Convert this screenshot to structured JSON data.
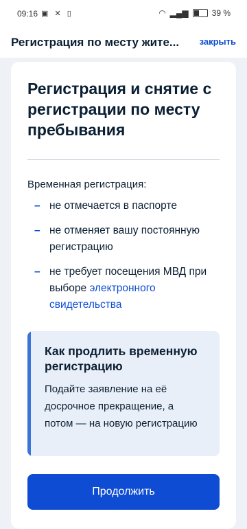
{
  "status_bar": {
    "time": "09:16",
    "battery_percent": "39 %",
    "icons": [
      "notification-icon",
      "mute-icon",
      "vibrate-icon",
      "wifi-icon",
      "volte-icon",
      "signal-icon",
      "battery-icon"
    ]
  },
  "header": {
    "title": "Регистрация по месту жите...",
    "close_label": "закрыть"
  },
  "card": {
    "title": "Регистрация и снятие с регистрации по месту пребывания",
    "intro": "Временная регистрация:",
    "bullets": [
      "не отмечается в паспорте",
      "не отменяет вашу постоянную регистрацию",
      "не требует посещения МВД при выборе"
    ],
    "bullet3_link": "электронного свидетельства"
  },
  "info_box": {
    "title": "Как продлить временную регистрацию",
    "text": "Подайте заявление на её досрочное прекращение, а потом — на новую регистрацию"
  },
  "actions": {
    "continue_label": "Продолжить"
  },
  "colors": {
    "accent": "#0d4cd3",
    "background": "#eef1f6",
    "info_bg": "#e9eff8"
  }
}
